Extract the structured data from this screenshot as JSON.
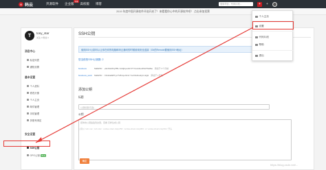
{
  "nav": {
    "logo": "码云",
    "logo_mark": "G",
    "links": [
      "开源软件",
      "企业版",
      "高校版",
      "博客"
    ],
    "link_badge": "特惠",
    "search_placeholder": "搜索项目、代码片段...",
    "red_icon": "+",
    "plus_icon": "+"
  },
  "announcement": {
    "text": "2019 年度中国开源软件评选开启了！来看看你心中的开源软件吧！ 点击参加投票",
    "close": "×"
  },
  "dropdown": {
    "items": [
      {
        "label": "个人主页",
        "icon": "home-icon"
      },
      {
        "label": "设置",
        "icon": "gear-icon"
      },
      {
        "label": "代码片段",
        "icon": "code-icon"
      },
      {
        "label": "帮助",
        "icon": "help-icon"
      },
      {
        "label": "退出",
        "icon": "logout-icon"
      }
    ]
  },
  "sidebar": {
    "avatar_letter": "T",
    "username": "tony_star",
    "follow": "关注 0  粉丝 0",
    "sections": [
      {
        "title": "消息中心",
        "items": [
          "私信列表",
          "通知设置"
        ]
      },
      {
        "title": "基本设置",
        "items": [
          "个人资料",
          "修改头像",
          "个人主页",
          "邮件管理",
          "手机管理",
          "多账号绑定"
        ]
      },
      {
        "title": "安全设置",
        "items": [
          "SSH公钥",
          "GPG公钥"
        ]
      }
    ],
    "gpg_badge": "Beta",
    "active_item": "SSH公钥"
  },
  "main": {
    "title": "SSH公钥",
    "info": "使用SSH公钥可以让你在你的电脑和码云通讯的时候使用安全连接（Git的Remote要使用SSH地址）",
    "keys_count_label": "您当前的SSH公钥数: 2",
    "keys": [
      {
        "name": "business",
        "fingerprint": "SHA256: +Hk3Vw5hpfMLr8cQbpe4277Yl1ub9uJPAVY9dNw",
        "added": "添加于 6个月前"
      },
      {
        "name": "business_work",
        "fingerprint": "SHA256: rUb3mmNP7ycfd5zqeXk1r7u2z0dbo9yhx8g0",
        "added": "添加于 1天前"
      }
    ],
    "add_title": "添加公钥",
    "title_label": "标题",
    "title_placeholder": "公钥标题(可选)",
    "key_label": "公钥",
    "key_placeholder": "把你的公钥粘贴到这里，查看 怎样生成公钥",
    "hint_text": "公钥以 'ssh-rsa', 'ssh-dss', 'ecdsa-sha2-nistp256', 'ecdsa-sha2-nistp384', or 'ecdsa-sha2-nistp521' 开头",
    "hint_link": "怎样生成公钥",
    "submit": "确定"
  },
  "watermark": "https://blog.csdn.net/...",
  "colors": {
    "nav_bg": "#2b3137",
    "brand_red": "#c71d23",
    "link_blue": "#2a7ad2",
    "submit_orange": "#f0803c",
    "highlight_red": "#e53935"
  }
}
